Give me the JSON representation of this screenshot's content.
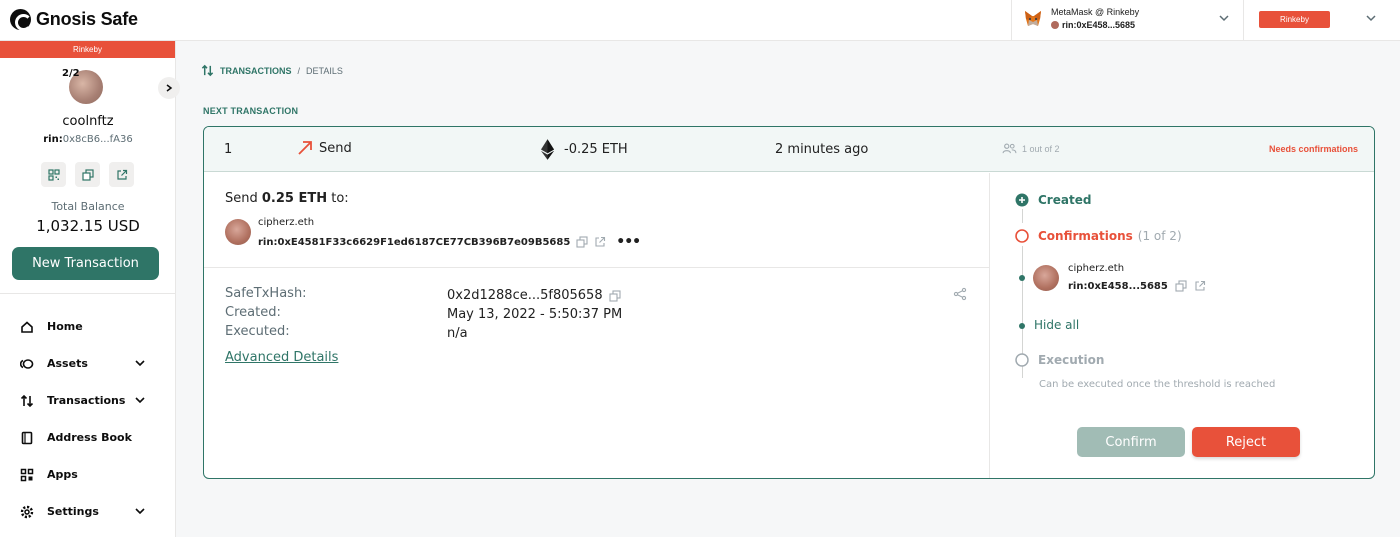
{
  "header": {
    "app_name": "Gnosis Safe",
    "wallet_name": "MetaMask @ Rinkeby",
    "wallet_address": "rin:0xE458...5685",
    "network": "Rinkeby"
  },
  "sidebar": {
    "network": "Rinkeby",
    "owners_badge": "2/2",
    "safe_name": "coolnftz",
    "safe_address_prefix": "rin:",
    "safe_address": "0x8cB6...fA36",
    "total_balance_label": "Total Balance",
    "total_balance_value": "1,032.15 USD",
    "new_transaction_label": "New Transaction",
    "nav": [
      {
        "label": "Home",
        "icon": "home-icon",
        "expandable": false
      },
      {
        "label": "Assets",
        "icon": "assets-icon",
        "expandable": true
      },
      {
        "label": "Transactions",
        "icon": "transactions-icon",
        "expandable": true
      },
      {
        "label": "Address Book",
        "icon": "address-book-icon",
        "expandable": false
      },
      {
        "label": "Apps",
        "icon": "apps-icon",
        "expandable": false
      },
      {
        "label": "Settings",
        "icon": "settings-icon",
        "expandable": true
      }
    ]
  },
  "breadcrumb": {
    "section": "TRANSACTIONS",
    "separator": "/",
    "current": "DETAILS"
  },
  "main": {
    "section_title": "NEXT TRANSACTION",
    "tx": {
      "nonce": "1",
      "type": "Send",
      "amount": "-0.25 ETH",
      "time": "2 minutes ago",
      "confirmations": "1 out of 2",
      "status": "Needs confirmations",
      "send_prefix": "Send ",
      "send_amount": "0.25 ETH",
      "send_suffix": " to:",
      "recipient_name": "cipherz.eth",
      "recipient_prefix": "rin:",
      "recipient_address": "0xE4581F33c6629F1ed6187CE77CB396B7e09B5685",
      "details": [
        {
          "label": "SafeTxHash:",
          "value": "0x2d1288ce...5f805658"
        },
        {
          "label": "Created:",
          "value": "May 13, 2022 - 5:50:37 PM"
        },
        {
          "label": "Executed:",
          "value": "n/a"
        }
      ],
      "advanced_details_label": "Advanced Details"
    },
    "timeline": {
      "created_label": "Created",
      "confirmations_label": "Confirmations",
      "confirmations_count": "(1 of 2)",
      "owner_name": "cipherz.eth",
      "owner_prefix": "rin:",
      "owner_address": "0xE458...5685",
      "hide_all_label": "Hide all",
      "execution_label": "Execution",
      "execution_note": "Can be executed once the threshold is reached"
    },
    "actions": {
      "confirm_label": "Confirm",
      "reject_label": "Reject"
    }
  },
  "colors": {
    "primary": "#2f7567",
    "danger": "#e8513a",
    "muted": "#a1aab0"
  }
}
